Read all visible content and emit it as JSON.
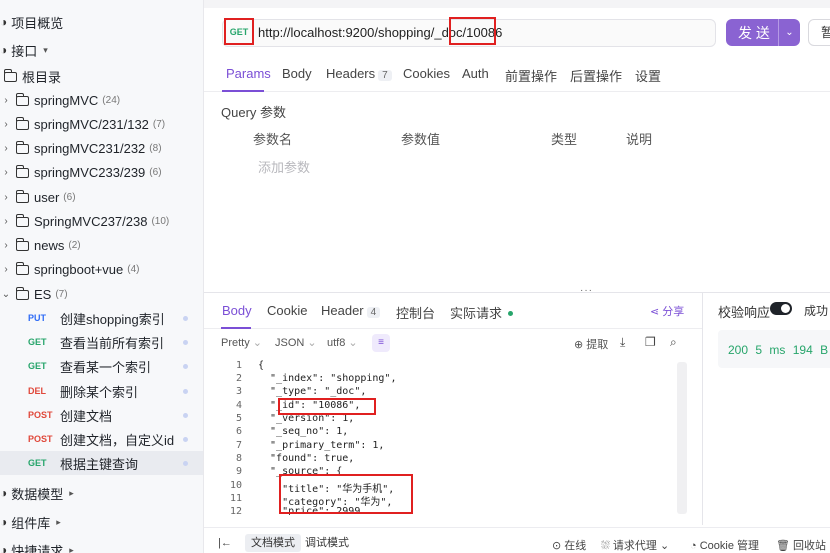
{
  "sidebar": {
    "top_items": [
      {
        "label": "项目概览"
      },
      {
        "label": "接口"
      },
      {
        "label": "根目录"
      }
    ],
    "folders": [
      {
        "label": "springMVC",
        "count": "(24)"
      },
      {
        "label": "springMVC/231/132",
        "count": "(7)"
      },
      {
        "label": "springMVC231/232",
        "count": "(8)"
      },
      {
        "label": "springMVC233/239",
        "count": "(6)"
      },
      {
        "label": "user",
        "count": "(6)"
      },
      {
        "label": "SpringMVC237/238",
        "count": "(10)"
      },
      {
        "label": "news",
        "count": "(2)"
      },
      {
        "label": "springboot+vue",
        "count": "(4)"
      },
      {
        "label": "ES",
        "count": "(7)"
      }
    ],
    "endpoints": [
      {
        "method": "PUT",
        "label": "创建shopping索引"
      },
      {
        "method": "GET",
        "label": "查看当前所有索引"
      },
      {
        "method": "GET",
        "label": "查看某一个索引"
      },
      {
        "method": "DEL",
        "label": "删除某个索引"
      },
      {
        "method": "POST",
        "label": "创建文档"
      },
      {
        "method": "POST",
        "label": "创建文档，自定义id"
      },
      {
        "method": "GET",
        "label": "根据主键查询"
      }
    ],
    "bottom_items": [
      {
        "label": "数据模型"
      },
      {
        "label": "组件库"
      },
      {
        "label": "快捷请求"
      }
    ]
  },
  "request": {
    "method": "GET",
    "url_prefix": "http://localhost:9200/shopping/_doc/",
    "url_id": "10086",
    "send_label": "发 送",
    "save_label": "暂"
  },
  "request_tabs": [
    {
      "label": "Params"
    },
    {
      "label": "Body"
    },
    {
      "label": "Headers",
      "badge": "7"
    },
    {
      "label": "Cookies"
    },
    {
      "label": "Auth"
    },
    {
      "label": "前置操作"
    },
    {
      "label": "后置操作"
    },
    {
      "label": "设置"
    }
  ],
  "query": {
    "title": "Query 参数",
    "headers": [
      "参数名",
      "参数值",
      "类型",
      "说明"
    ],
    "add_placeholder": "添加参数"
  },
  "response_tabs": [
    {
      "label": "Body"
    },
    {
      "label": "Cookie"
    },
    {
      "label": "Header",
      "badge": "4"
    },
    {
      "label": "控制台"
    },
    {
      "label": "实际请求"
    }
  ],
  "share_label": "分享",
  "response_tools": {
    "format": "Pretty",
    "lang": "JSON",
    "encoding": "utf8",
    "extract": "提取"
  },
  "code_lines": [
    "{",
    "  \"_index\": \"shopping\",",
    "  \"_type\": \"_doc\",",
    "  \"_id\": \"10086\",",
    "  \"_version\": 1,",
    "  \"_seq_no\": 1,",
    "  \"_primary_term\": 1,",
    "  \"found\": true,",
    "  \"_source\": {",
    "    \"title\": \"华为手机\",",
    "    \"category\": \"华为\",",
    "    \"price\": 2999"
  ],
  "verify": {
    "label": "校验响应",
    "success": "成功",
    "status": "200",
    "time": "5 ms",
    "size": "194 B"
  },
  "statusbar": {
    "doc_mode": "文档模式",
    "debug_mode": "调试模式",
    "online": "在线",
    "proxy": "请求代理",
    "cookie_mgmt": "Cookie 管理",
    "recycle": "回收站"
  }
}
